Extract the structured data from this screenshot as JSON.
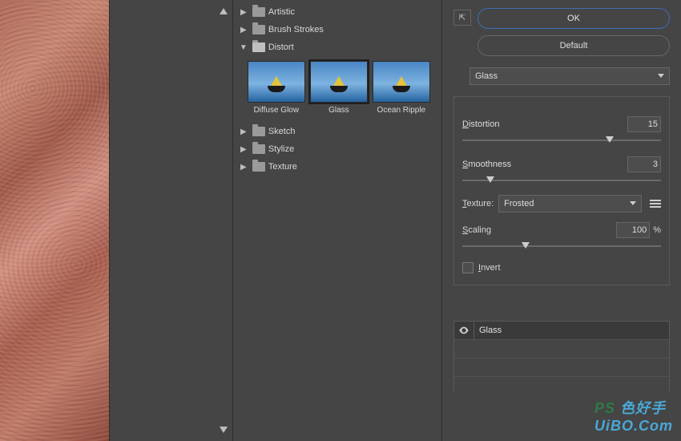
{
  "categories": {
    "artistic": "Artistic",
    "brush": "Brush Strokes",
    "distort": "Distort",
    "sketch": "Sketch",
    "stylize": "Stylize",
    "texture": "Texture"
  },
  "thumbs": {
    "diffuse": "Diffuse Glow",
    "glass": "Glass",
    "ocean": "Ocean Ripple"
  },
  "buttons": {
    "ok": "OK",
    "default": "Default"
  },
  "filter_select": "Glass",
  "params": {
    "distortion_label_pre": "D",
    "distortion_label": "istortion",
    "distortion_value": "15",
    "smooth_label_pre": "S",
    "smooth_label": "moothness",
    "smooth_value": "3",
    "texture_label_pre": "T",
    "texture_label": "exture:",
    "texture_value": "Frosted",
    "scaling_label_pre": "S",
    "scaling_label": "caling",
    "scaling_value": "100",
    "scaling_unit": "%",
    "invert_label_pre": "I",
    "invert_label": "nvert"
  },
  "layer": {
    "name": "Glass"
  },
  "watermark": {
    "a": "PS",
    "b": "色好手",
    "c": "UiBO.Com"
  },
  "collapse": "⇱"
}
